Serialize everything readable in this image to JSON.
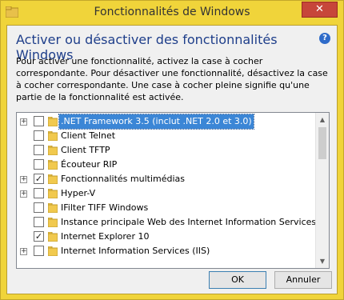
{
  "window": {
    "title": "Fonctionnalités de Windows",
    "close_label": "✕"
  },
  "dialog": {
    "heading": "Activer ou désactiver des fonctionnalités Windows",
    "help_glyph": "?",
    "description": "Pour activer une fonctionnalité, activez la case à cocher correspondante. Pour désactiver une fonctionnalité, désactivez la case à cocher correspondante. Une case à cocher pleine signifie qu'une partie de la fonctionnalité est activée."
  },
  "features": [
    {
      "label": ".NET Framework 3.5 (inclut .NET 2.0 et 3.0)",
      "checked": false,
      "expandable": true,
      "selected": true
    },
    {
      "label": "Client Telnet",
      "checked": false,
      "expandable": false,
      "selected": false
    },
    {
      "label": "Client TFTP",
      "checked": false,
      "expandable": false,
      "selected": false
    },
    {
      "label": "Écouteur RIP",
      "checked": false,
      "expandable": false,
      "selected": false
    },
    {
      "label": "Fonctionnalités multimédias",
      "checked": true,
      "expandable": true,
      "selected": false
    },
    {
      "label": "Hyper-V",
      "checked": false,
      "expandable": true,
      "selected": false
    },
    {
      "label": "IFilter TIFF Windows",
      "checked": false,
      "expandable": false,
      "selected": false
    },
    {
      "label": "Instance principale Web des Internet Information Services (IIS)",
      "checked": false,
      "expandable": false,
      "selected": false
    },
    {
      "label": "Internet Explorer 10",
      "checked": true,
      "expandable": false,
      "selected": false
    },
    {
      "label": "Internet Information Services (IIS)",
      "checked": false,
      "expandable": true,
      "selected": false
    }
  ],
  "glyphs": {
    "expand": "+",
    "check": "✓",
    "scroll_up": "▲",
    "scroll_down": "▼"
  },
  "buttons": {
    "ok": "OK",
    "cancel": "Annuler"
  },
  "colors": {
    "frame": "#f0d43a",
    "close": "#c7463a",
    "selection": "#3b86d6",
    "heading": "#1e3e8a"
  }
}
